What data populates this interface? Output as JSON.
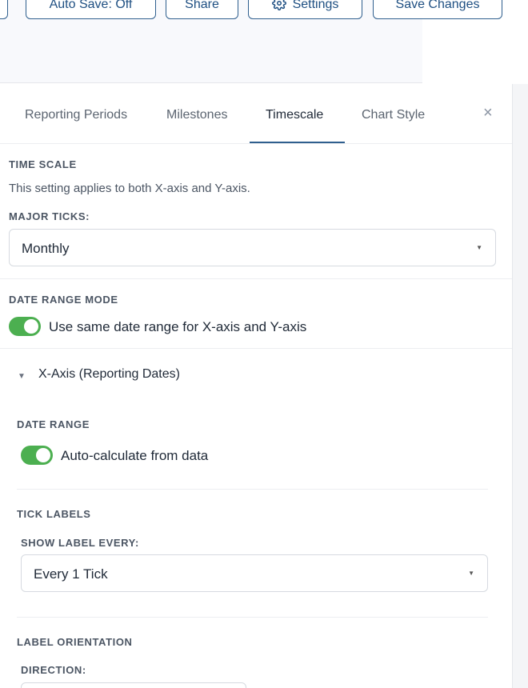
{
  "toolbar": {
    "autosave_label": "Auto Save: Off",
    "share_label": "Share",
    "settings_label": "Settings",
    "save_label": "Save Changes"
  },
  "tabs": {
    "reporting": "Reporting Periods",
    "milestones": "Milestones",
    "timescale": "Timescale",
    "chartstyle": "Chart Style",
    "active": "Timescale"
  },
  "close_label": "×",
  "time_scale": {
    "heading": "TIME SCALE",
    "help": "This setting applies to both X-axis and Y-axis.",
    "major_ticks_label": "MAJOR TICKS:",
    "major_ticks_value": "Monthly"
  },
  "date_range_mode": {
    "heading": "DATE RANGE MODE",
    "toggle_label": "Use same date range for X-axis and Y-axis",
    "toggle_on": true
  },
  "x_axis": {
    "title": "X-Axis (Reporting Dates)",
    "date_range_heading": "DATE RANGE",
    "auto_calc_label": "Auto-calculate from data",
    "auto_calc_on": true,
    "tick_labels_heading": "TICK LABELS",
    "show_label_every_label": "SHOW LABEL EVERY:",
    "show_label_every_value": "Every 1 Tick",
    "label_orientation_heading": "LABEL ORIENTATION",
    "direction_label": "DIRECTION:"
  },
  "colors": {
    "accent": "#2f5f8e",
    "toggle_on": "#4caf50"
  }
}
